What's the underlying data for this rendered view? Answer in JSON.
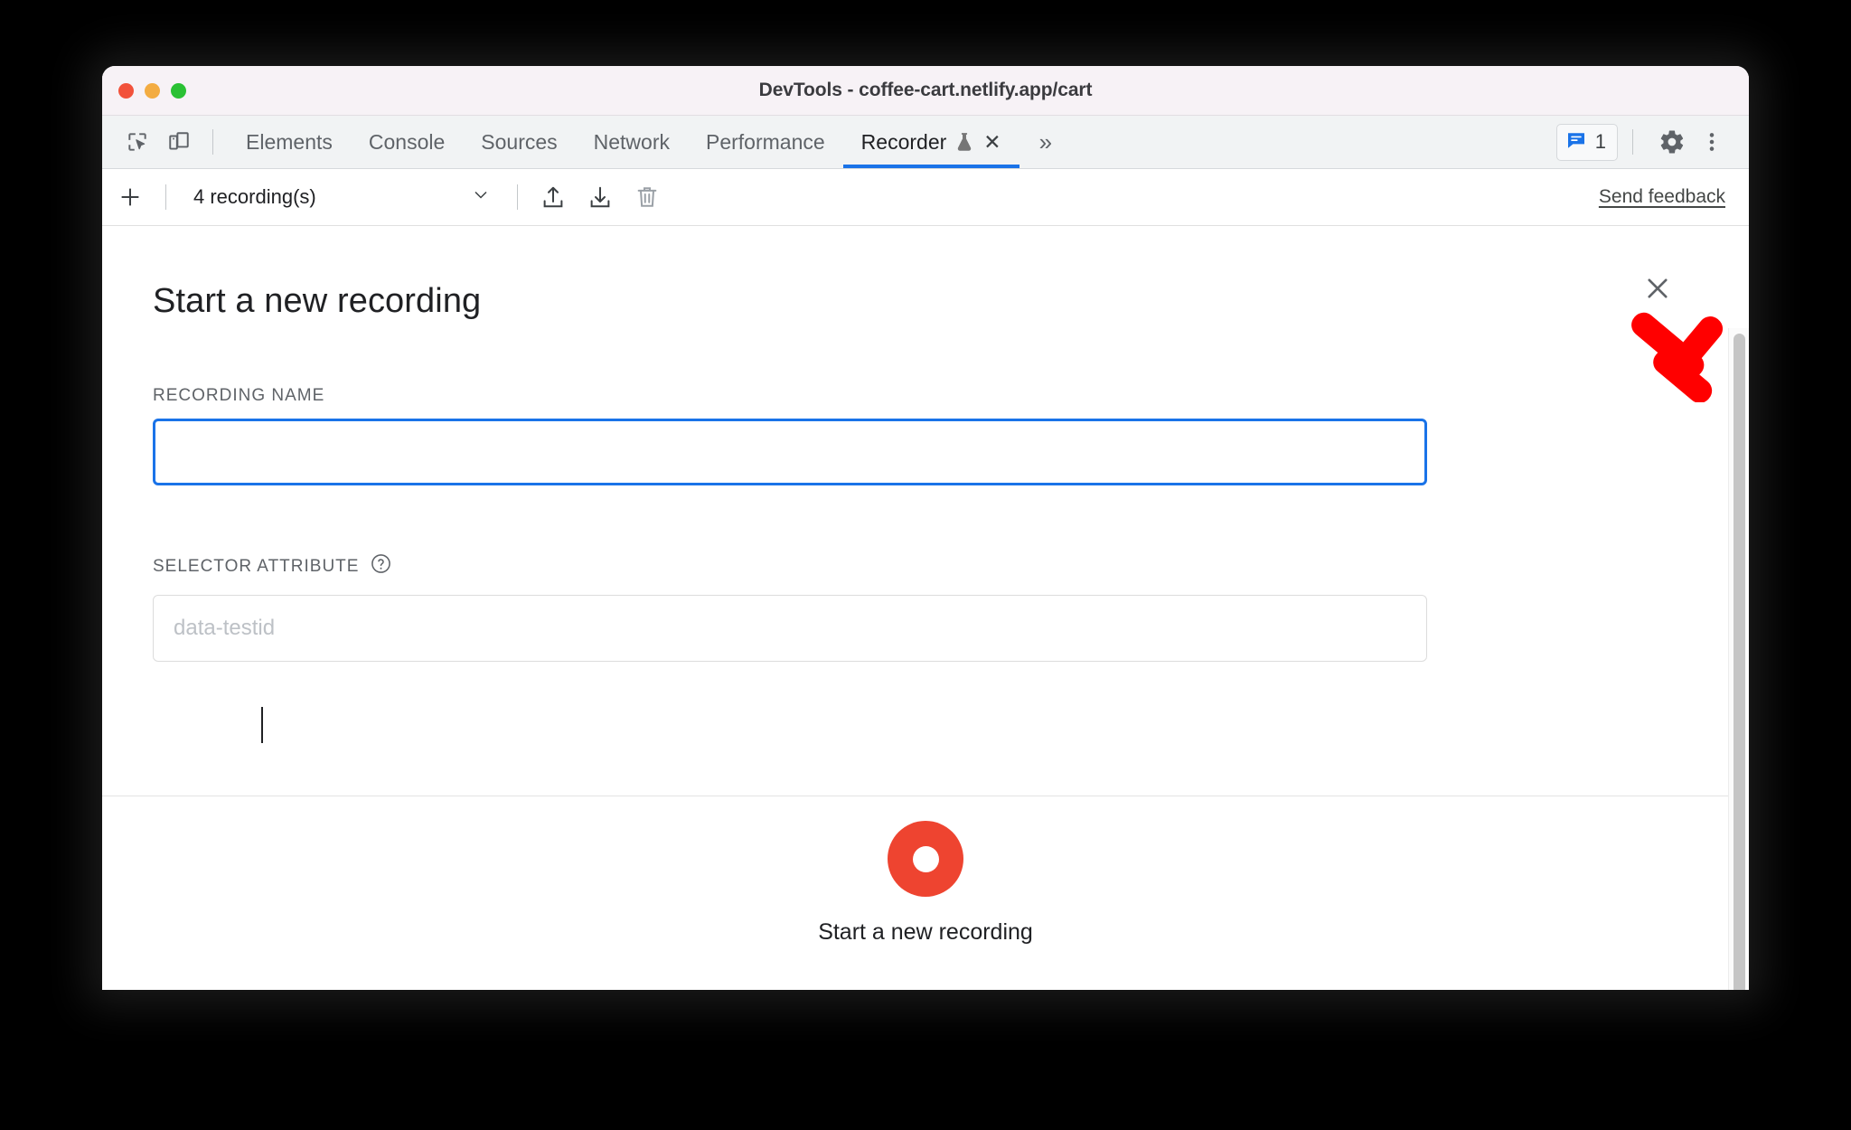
{
  "window": {
    "title": "DevTools - coffee-cart.netlify.app/cart",
    "traffic_lights": {
      "close": "close-window",
      "minimize": "minimize-window",
      "maximize": "maximize-window"
    }
  },
  "tabstrip": {
    "inspect_icon": "inspect-element-icon",
    "device_icon": "device-toolbar-icon",
    "tabs": [
      {
        "label": "Elements",
        "active": false
      },
      {
        "label": "Console",
        "active": false
      },
      {
        "label": "Sources",
        "active": false
      },
      {
        "label": "Network",
        "active": false
      },
      {
        "label": "Performance",
        "active": false
      },
      {
        "label": "Recorder",
        "active": true,
        "experimental_icon": "flask-icon",
        "close_glyph": "✕"
      }
    ],
    "more_tabs_glyph": "»",
    "issues": {
      "icon": "issues-message-icon",
      "count": "1",
      "accent": "#1a73e8"
    },
    "settings_icon": "gear-icon",
    "menu_icon": "kebab-menu-icon"
  },
  "recorder_toolbar": {
    "add_icon": "plus-icon",
    "recordings_label": "4 recording(s)",
    "dropdown_glyph": "chevron-down-icon",
    "export_icon": "export-upload-icon",
    "import_icon": "import-download-icon",
    "delete_icon": "trash-delete-icon",
    "feedback_label": "Send feedback"
  },
  "panel": {
    "close_glyph": "✕",
    "heading": "Start a new recording",
    "fields": [
      {
        "label": "RECORDING NAME",
        "value": "",
        "placeholder": "",
        "focused": true,
        "help_icon": null
      },
      {
        "label": "SELECTOR ATTRIBUTE",
        "value": "",
        "placeholder": "data-testid",
        "focused": false,
        "help_icon": "help-question-icon"
      }
    ],
    "cta": {
      "icon": "record-donut-icon",
      "label": "Start a new recording",
      "color": "#ee4430"
    }
  },
  "annotation": {
    "arrow": "red-arrow-pointing-to-close-button",
    "color": "#ff0000"
  }
}
